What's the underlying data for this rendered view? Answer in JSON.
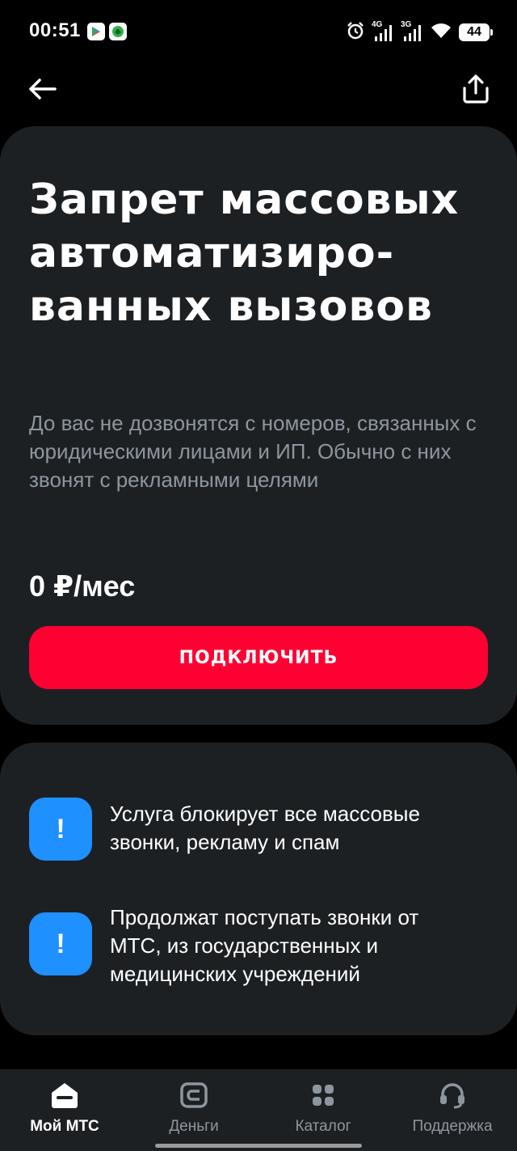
{
  "status_bar": {
    "time": "00:51",
    "network1": "4G",
    "network2": "3G",
    "battery": "44",
    "icons": [
      "play-store-icon",
      "app-notification-icon",
      "alarm-icon",
      "signal-4g-icon",
      "signal-3g-icon",
      "wifi-icon",
      "battery-icon"
    ]
  },
  "header": {
    "back_icon": "arrow-left-icon",
    "share_icon": "share-icon"
  },
  "service": {
    "title": "Запрет массовых автоматизиро-ванных вызовов",
    "description": "До вас не дозвонятся с номеров, связанных с юридическими лицами и ИП. Обычно с них звонят с рекламными целями",
    "price": "0 ₽/мес",
    "connect_label": "ПОДКЛЮЧИТЬ"
  },
  "info": {
    "items": [
      {
        "icon": "exclamation-icon",
        "glyph": "!",
        "text": "Услуга блокирует все массовые звонки, рекламу и спам"
      },
      {
        "icon": "exclamation-icon",
        "glyph": "!",
        "text": "Продолжат поступать звонки от МТС, из государственных и медицинских учреждений"
      }
    ]
  },
  "bottom_nav": {
    "items": [
      {
        "label": "Мой МТС",
        "icon": "home-icon",
        "active": true
      },
      {
        "label": "Деньги",
        "icon": "money-icon",
        "active": false
      },
      {
        "label": "Каталог",
        "icon": "catalog-icon",
        "active": false
      },
      {
        "label": "Поддержка",
        "icon": "support-icon",
        "active": false
      }
    ]
  },
  "colors": {
    "background": "#000000",
    "card": "#1d2023",
    "accent_red": "#ff0032",
    "info_blue": "#1e90ff",
    "muted_text": "#8d969e"
  }
}
